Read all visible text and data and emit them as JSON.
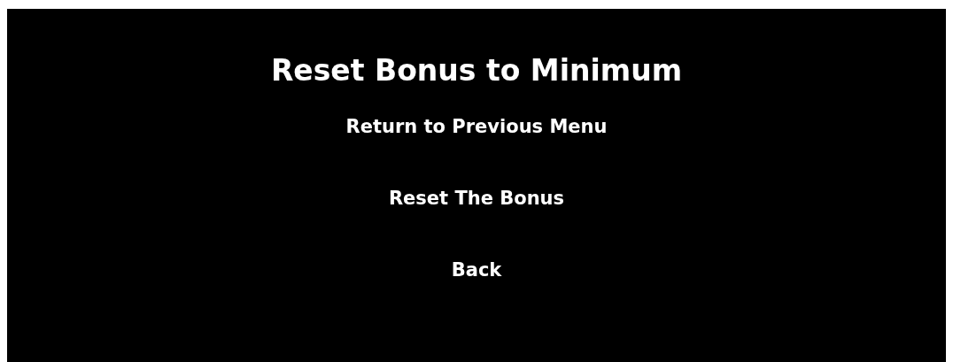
{
  "title": "Reset Bonus to Minimum",
  "menu": [
    {
      "label": "Return to Previous Menu"
    },
    {
      "label": "Reset The Bonus"
    },
    {
      "label": "Back"
    }
  ]
}
